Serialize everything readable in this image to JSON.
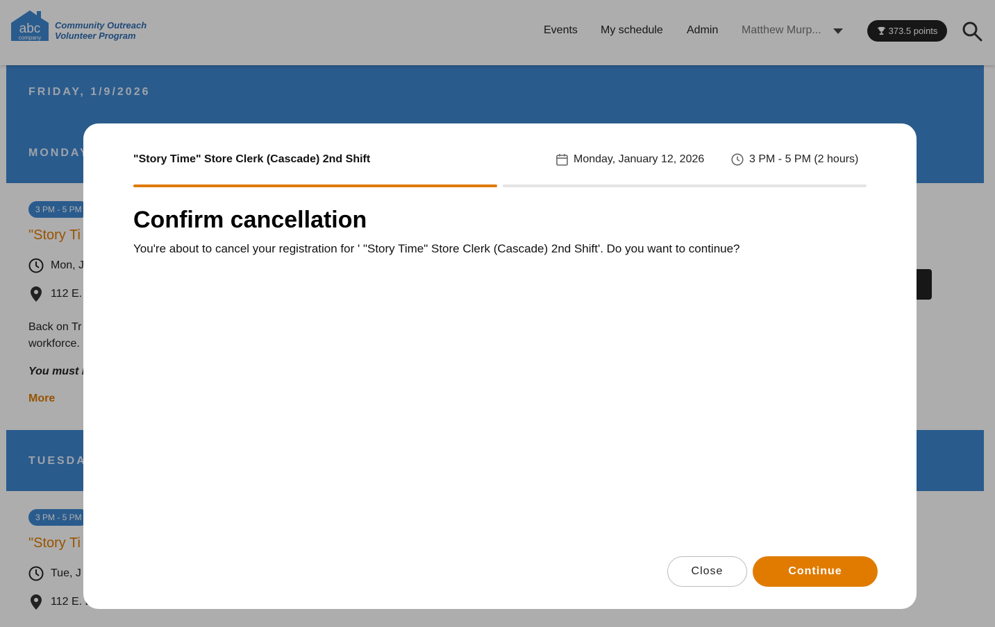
{
  "header": {
    "logo_main": "abc",
    "logo_sub": "company",
    "program_line1": "Community Outreach",
    "program_line2": "Volunteer Program",
    "nav": {
      "events": "Events",
      "schedule": "My schedule",
      "admin": "Admin",
      "user": "Matthew Murp..."
    },
    "points": "373.5 points"
  },
  "background": {
    "date_1": "FRIDAY, 1/9/2026",
    "date_2": "MONDAY",
    "date_3": "TUESDAY",
    "card_1": {
      "time": "3 PM - 5 PM",
      "title": "\"Story Ti",
      "date": "Mon, J",
      "location": "112 E.",
      "desc_1": "Back on Tr",
      "desc_2": "workforce.",
      "note": "You must b",
      "more": "More"
    },
    "card_2": {
      "time": "3 PM - 5 PM",
      "title": "\"Story Ti",
      "date": "Tue, J",
      "location": "112 E. L"
    }
  },
  "modal": {
    "event_title": "\"Story Time\" Store Clerk (Cascade) 2nd Shift",
    "date": "Monday, January 12, 2026",
    "time": "3 PM - 5 PM (2 hours)",
    "heading": "Confirm cancellation",
    "body": "You're about to cancel your registration for ' \"Story Time\" Store Clerk (Cascade) 2nd Shift'. Do you want to continue?",
    "close_label": "Close",
    "continue_label": "Continue"
  },
  "colors": {
    "brand_blue": "#3f86d0",
    "accent_orange": "#e07b00"
  }
}
